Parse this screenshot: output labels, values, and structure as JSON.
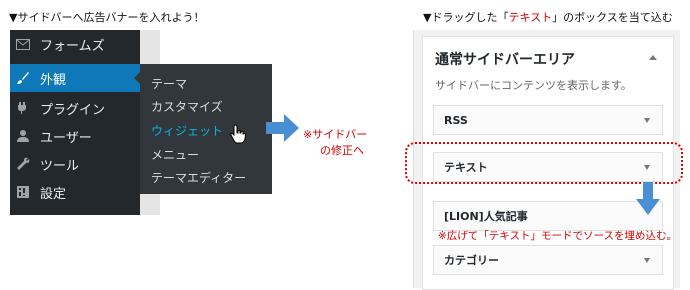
{
  "captions": {
    "left": "▼サイドバーへ広告バナーを入れよう！",
    "right_prefix": "▼ドラッグした「",
    "right_highlight": "テキスト",
    "right_suffix": "」のボックスを当て込む"
  },
  "admin_menu": {
    "items": [
      {
        "label": "フォームズ",
        "icon": "envelope-icon"
      },
      {
        "label": "外観",
        "icon": "brush-icon",
        "active": true
      },
      {
        "label": "プラグイン",
        "icon": "plugin-icon"
      },
      {
        "label": "ユーザー",
        "icon": "user-icon"
      },
      {
        "label": "ツール",
        "icon": "wrench-icon"
      },
      {
        "label": "設定",
        "icon": "settings-icon"
      }
    ],
    "submenu": [
      {
        "label": "テーマ"
      },
      {
        "label": "カスタマイズ"
      },
      {
        "label": "ウィジェット",
        "current": true
      },
      {
        "label": "メニュー"
      },
      {
        "label": "テーマエディター"
      }
    ]
  },
  "notes": {
    "sidebar_edit_line1": "※サイドバー",
    "sidebar_edit_line2": "の修正へ",
    "expand_note": "※広げて「テキスト」モードでソースを埋め込む。"
  },
  "widget_area": {
    "title": "通常サイドバーエリア",
    "description": "サイドバーにコンテンツを表示します。",
    "widgets": [
      {
        "label": "RSS"
      },
      {
        "label": "テキスト"
      },
      {
        "label": "[LION]人気記事"
      },
      {
        "label": "カテゴリー"
      }
    ]
  },
  "colors": {
    "menu_bg": "#23282d",
    "submenu_bg": "#32373c",
    "active_blue": "#0f78b8",
    "current_link": "#00b9eb",
    "arrow_blue": "#4a8fd4",
    "note_red": "#d40000"
  }
}
